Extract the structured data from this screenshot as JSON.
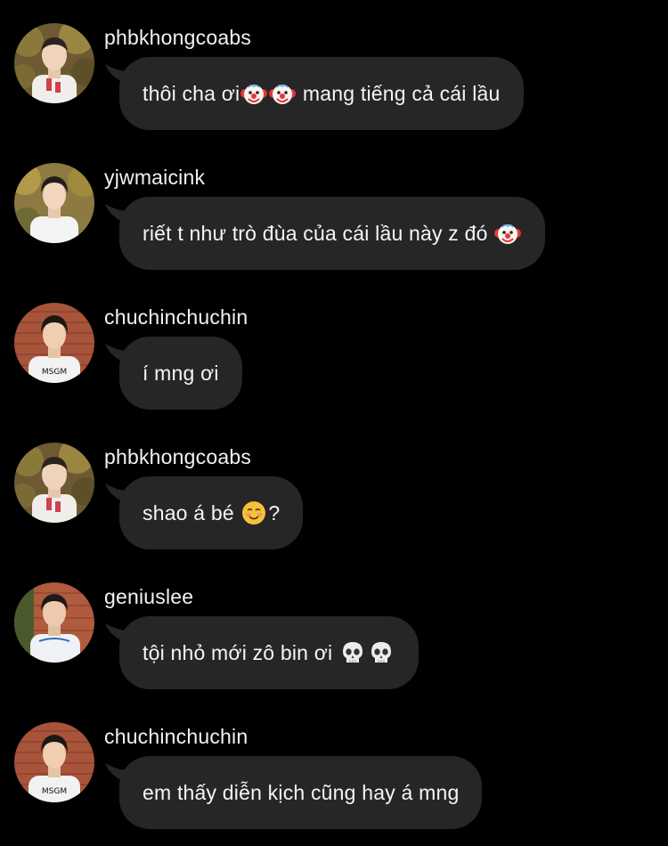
{
  "colors": {
    "background": "#000000",
    "bubble": "#262626",
    "text": "#f5f5f5"
  },
  "messages": [
    {
      "username": "phbkhongcoabs",
      "avatar_icon": "avatar-photo-icon",
      "parts": [
        {
          "text": "thôi cha ơi "
        },
        {
          "emoji": "clown-face-icon"
        },
        {
          "emoji": "clown-face-icon"
        },
        {
          "text": " mang tiếng cả cái lầu"
        }
      ]
    },
    {
      "username": "yjwmaicink",
      "avatar_icon": "avatar-photo-icon",
      "parts": [
        {
          "text": "riết t như trò đùa của cái lầu này z đó "
        },
        {
          "emoji": "clown-face-icon"
        }
      ]
    },
    {
      "username": "chuchinchuchin",
      "avatar_icon": "avatar-photo-icon",
      "parts": [
        {
          "text": "í mng ơi"
        }
      ]
    },
    {
      "username": "phbkhongcoabs",
      "avatar_icon": "avatar-photo-icon",
      "parts": [
        {
          "text": "shao á bé "
        },
        {
          "emoji": "smiling-face-icon"
        },
        {
          "text": "?"
        }
      ]
    },
    {
      "username": "geniuslee",
      "avatar_icon": "avatar-photo-icon",
      "parts": [
        {
          "text": "tội nhỏ mới zô bin ơi "
        },
        {
          "emoji": "skull-icon"
        },
        {
          "emoji": "skull-icon"
        }
      ]
    },
    {
      "username": "chuchinchuchin",
      "avatar_icon": "avatar-photo-icon",
      "parts": [
        {
          "text": "em thấy diễn kịch cũng hay á mng"
        }
      ]
    }
  ]
}
